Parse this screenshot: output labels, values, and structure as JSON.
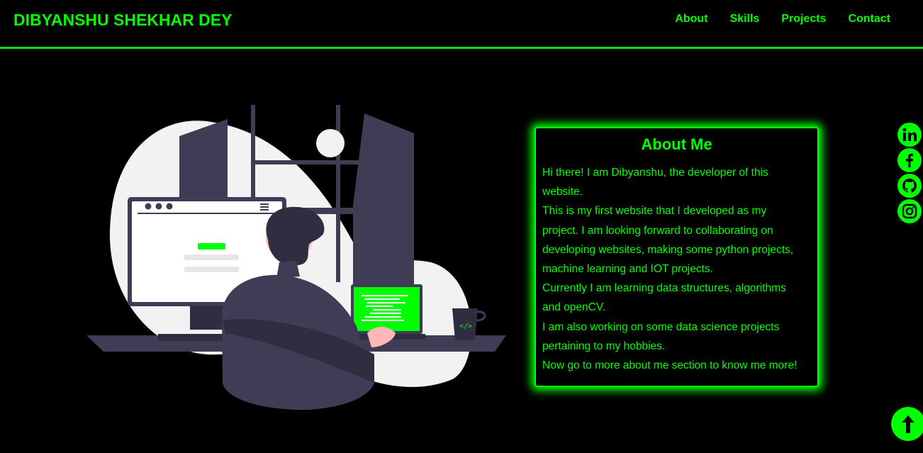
{
  "header": {
    "brand": "DIBYANSHU SHEKHAR DEY",
    "nav": [
      {
        "label": "About"
      },
      {
        "label": "Skills"
      },
      {
        "label": "Projects"
      },
      {
        "label": "Contact"
      }
    ]
  },
  "about": {
    "title": "About Me",
    "lines": [
      "Hi there! I am Dibyanshu, the developer of this",
      "website.",
      "This is my first website that I developed as my",
      "project. I am looking forward to collaborating on",
      "developing websites, making some python projects,",
      "machine learning and IOT projects.",
      "Currently I am learning data structures, algorithms",
      "and openCV.",
      "I am also working on some data science projects",
      "pertaining to my hobbies.",
      "Now go to more about me section to know me more!"
    ]
  },
  "social": [
    {
      "icon": "linkedin-icon"
    },
    {
      "icon": "facebook-icon"
    },
    {
      "icon": "github-icon"
    },
    {
      "icon": "instagram-icon"
    }
  ],
  "scroll_top": {
    "icon": "arrow-up-icon"
  },
  "colors": {
    "accent": "#00ff00",
    "background": "#000000"
  }
}
